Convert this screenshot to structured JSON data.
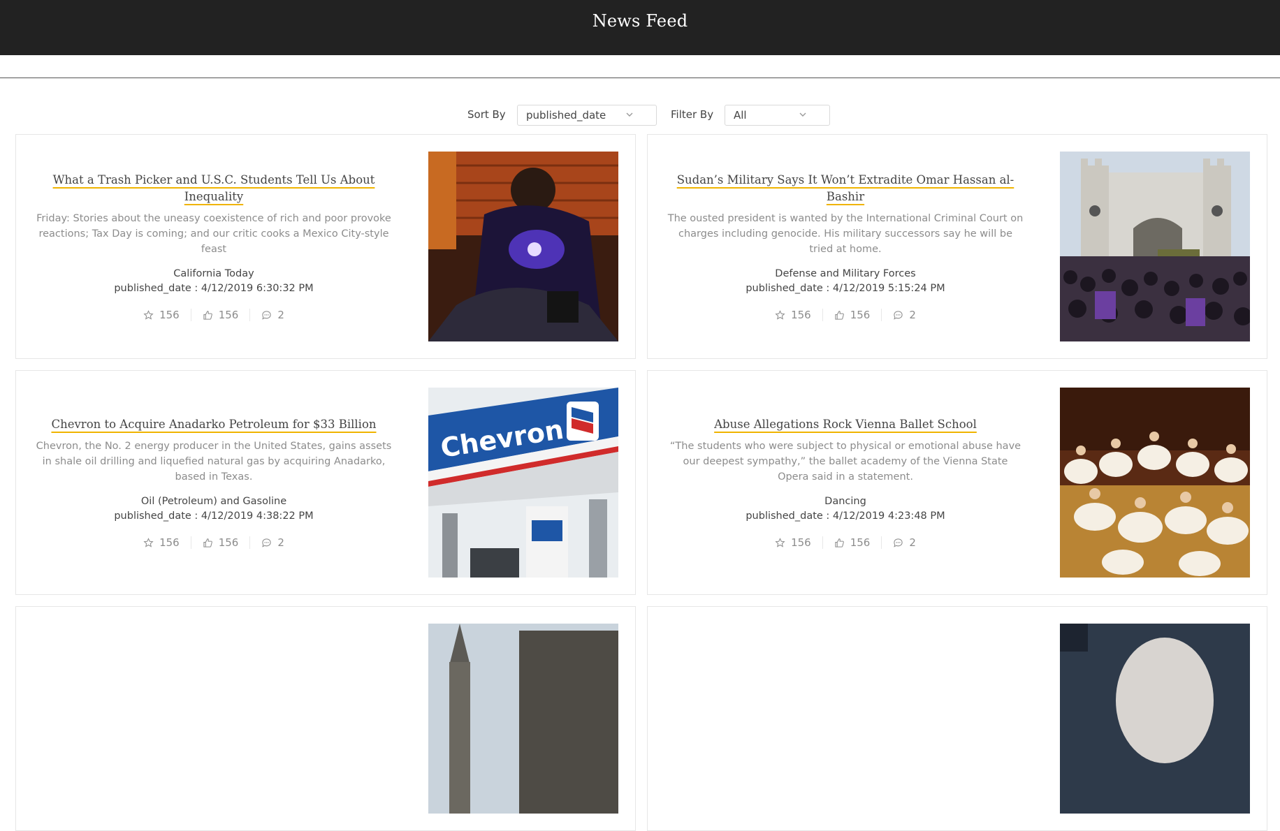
{
  "header": {
    "title": "News Feed"
  },
  "controls": {
    "sort_label": "Sort By",
    "sort_value": "published_date",
    "filter_label": "Filter By",
    "filter_value": "All"
  },
  "articles": [
    {
      "title": "What a Trash Picker and U.S.C. Students Tell Us About Inequality",
      "abstract": "Friday: Stories about the uneasy coexistence of rich and poor provoke reactions; Tax Day is coming; and our critic cooks a Mexico City-style feast",
      "section": "California Today",
      "date": "published_date : 4/12/2019 6:30:32 PM",
      "stars": "156",
      "likes": "156",
      "comments": "2",
      "image": "trash-picker-photo"
    },
    {
      "title": "Sudan’s Military Says It Won’t Extradite Omar Hassan al-Bashir",
      "abstract": "The ousted president is wanted by the International Criminal Court on charges including genocide. His military successors say he will be tried at home.",
      "section": "Defense and Military Forces",
      "date": "published_date : 4/12/2019 5:15:24 PM",
      "stars": "156",
      "likes": "156",
      "comments": "2",
      "image": "sudan-protest-photo"
    },
    {
      "title": "Chevron to Acquire Anadarko Petroleum for $33 Billion",
      "abstract": "Chevron, the No. 2 energy producer in the United States, gains assets in shale oil drilling and liquefied natural gas by acquiring Anadarko, based in Texas.",
      "section": "Oil (Petroleum) and Gasoline",
      "date": "published_date : 4/12/2019 4:38:22 PM",
      "stars": "156",
      "likes": "156",
      "comments": "2",
      "image": "chevron-station-photo",
      "image_text": "Chevron"
    },
    {
      "title": "Abuse Allegations Rock Vienna Ballet School",
      "abstract": "“The students who were subject to physical or emotional abuse have our deepest sympathy,” the ballet academy of the Vienna State Opera said in a statement.",
      "section": "Dancing",
      "date": "published_date : 4/12/2019 4:23:48 PM",
      "stars": "156",
      "likes": "156",
      "comments": "2",
      "image": "ballet-dancers-photo"
    }
  ],
  "colors": {
    "header_bg": "#222222",
    "title_underline": "#f0b400",
    "card_border": "#e6e6e6",
    "muted_text": "#8c8c8c"
  }
}
